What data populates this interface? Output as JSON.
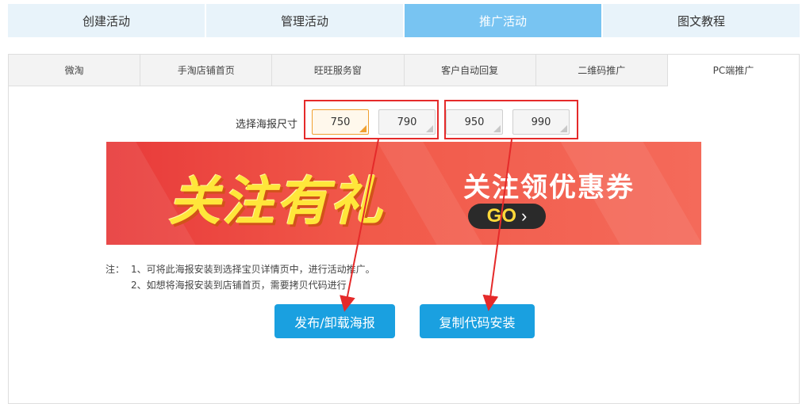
{
  "top_tabs": [
    {
      "label": "创建活动"
    },
    {
      "label": "管理活动"
    },
    {
      "label": "推广活动"
    },
    {
      "label": "图文教程"
    }
  ],
  "sub_tabs": [
    {
      "label": "微淘"
    },
    {
      "label": "手淘店铺首页"
    },
    {
      "label": "旺旺服务窗"
    },
    {
      "label": "客户自动回复"
    },
    {
      "label": "二维码推广"
    },
    {
      "label": "PC端推广"
    }
  ],
  "poster": {
    "size_label": "选择海报尺寸",
    "sizes": [
      "750",
      "790",
      "950",
      "990"
    ],
    "selected_size": "750"
  },
  "banner": {
    "title": "关注有礼",
    "subtitle": "关注领优惠券",
    "go_label": "GO",
    "go_arrow": "›"
  },
  "notes": {
    "prefix": "注：",
    "line1": "1、可将此海报安装到选择宝贝详情页中，进行活动推广。",
    "line2": "2、如想将海报安装到店铺首页，需要拷贝代码进行"
  },
  "actions": {
    "publish_label": "发布/卸载海报",
    "copy_label": "复制代码安装"
  },
  "colors": {
    "active_tab": "#78c4f2",
    "button_blue": "#1aa0e0",
    "annotation_red": "#e52a2a"
  }
}
